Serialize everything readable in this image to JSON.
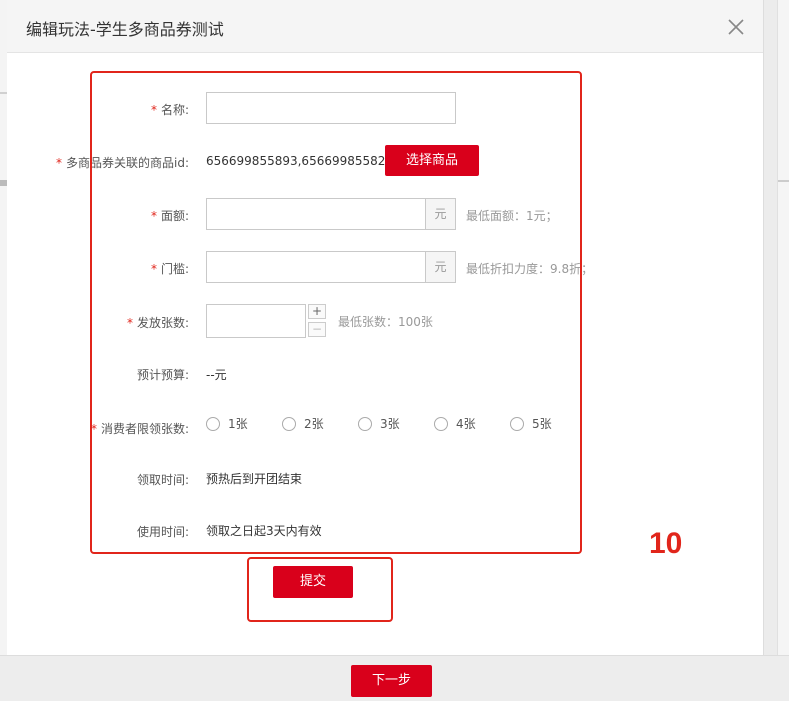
{
  "dialog": {
    "title": "编辑玩法-学生多商品券测试"
  },
  "form": {
    "name": {
      "label": "名称:",
      "value": ""
    },
    "product_ids": {
      "label": "多商品券关联的商品id:",
      "value": "656699855893,656699855823",
      "button": "选择商品"
    },
    "face_value": {
      "label": "面额:",
      "unit": "元",
      "hint": "最低面额：1元；"
    },
    "threshold": {
      "label": "门槛:",
      "unit": "元",
      "hint": "最低折扣力度：9.8折；"
    },
    "quantity": {
      "label": "发放张数:",
      "plus": "+",
      "minus": "−",
      "hint": "最低张数：100张"
    },
    "budget": {
      "label": "预计预算:",
      "value": "--元"
    },
    "limit": {
      "label": "消费者限领张数:",
      "options": [
        "1张",
        "2张",
        "3张",
        "4张",
        "5张"
      ]
    },
    "claim_time": {
      "label": "领取时间:",
      "value": "预热后到开团结束"
    },
    "use_time": {
      "label": "使用时间:",
      "value": "领取之日起3天内有效"
    },
    "submit": "提交"
  },
  "annotation": "10",
  "footer": {
    "next": "下一步"
  },
  "colors": {
    "accent": "#d9001b",
    "highlight": "#e1251b"
  }
}
